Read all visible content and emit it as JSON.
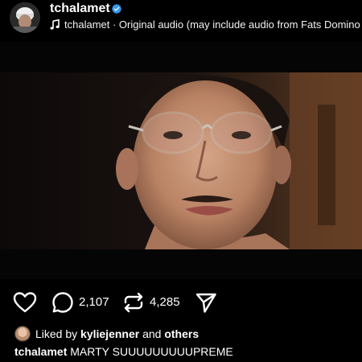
{
  "post": {
    "username": "tchalamet",
    "audio": {
      "text": "tchalamet · Original audio  (may include audio from Fats Domino"
    },
    "actions": {
      "comments_count": "2,107",
      "reposts_count": "4,285"
    },
    "likes": {
      "prefix": "Liked by",
      "user": "kyliejenner",
      "and": "and",
      "others": "others"
    },
    "caption": {
      "user": "tchalamet",
      "text": "MARTY SUUUUUUUUUPREME"
    }
  },
  "colors": {
    "background": "#000000",
    "text": "#ffffff",
    "verified_badge": "#3897f0"
  },
  "icons": {
    "verified": "verified-badge-icon",
    "music": "music-note-icon",
    "like": "heart-icon",
    "comment": "comment-icon",
    "repost": "repost-icon",
    "share": "send-icon"
  }
}
